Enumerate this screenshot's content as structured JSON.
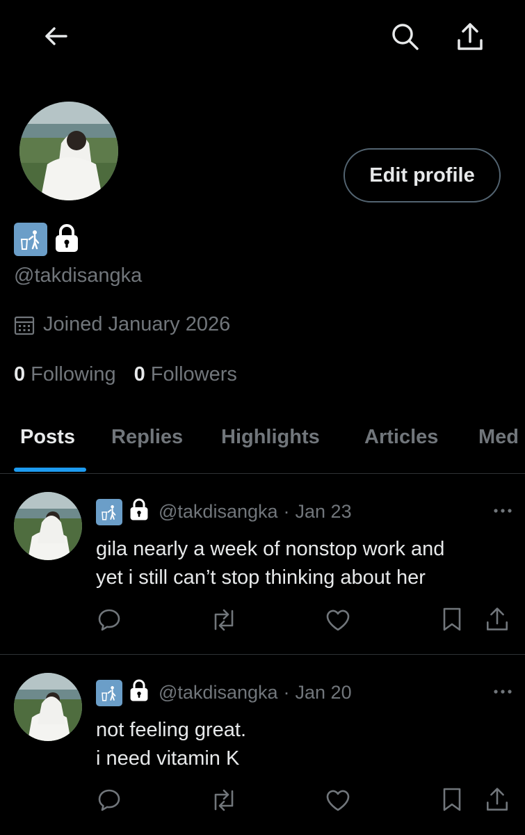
{
  "profile": {
    "handle": "@takdisangka",
    "joined": "Joined January 2026",
    "following_count": "0",
    "following_label": "Following",
    "followers_count": "0",
    "followers_label": "Followers",
    "edit_label": "Edit profile",
    "badge_icons": [
      "litter-in-bin-emoji-icon",
      "lock-icon"
    ]
  },
  "header": {
    "icons": [
      "back-arrow-icon",
      "search-icon",
      "share-icon"
    ]
  },
  "tabs": [
    {
      "label": "Posts",
      "active": true
    },
    {
      "label": "Replies"
    },
    {
      "label": "Highlights"
    },
    {
      "label": "Articles"
    },
    {
      "label": "Med"
    }
  ],
  "posts": [
    {
      "handle": "@takdisangka",
      "sep": "·",
      "date": "Jan 23",
      "text": "gila nearly a week of nonstop work and\nyet i still can’t stop thinking about her"
    },
    {
      "handle": "@takdisangka",
      "sep": "·",
      "date": "Jan 20",
      "text": "not feeling great.\ni need vitamin K"
    }
  ],
  "colors": {
    "background": "#000000",
    "text": "#e7e9ea",
    "muted": "#71767b",
    "accent": "#1d9bf0",
    "border": "#2f3336"
  }
}
